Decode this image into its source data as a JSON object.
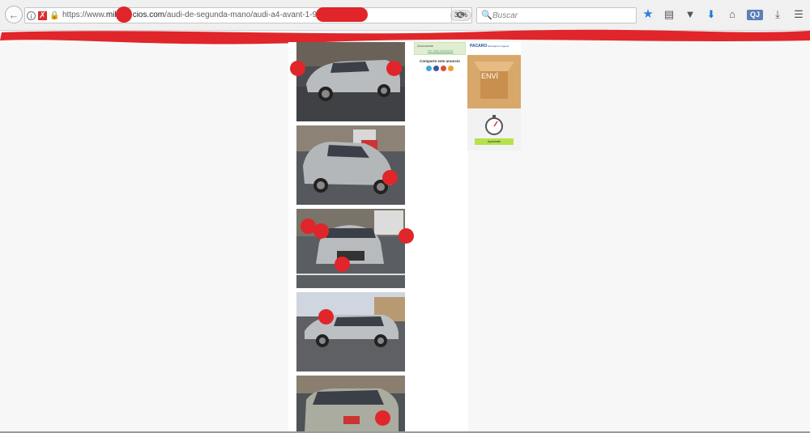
{
  "browser": {
    "back_icon": "arrow-left-icon",
    "url_prefix": "https://www.",
    "url_domain_part1": "mil",
    "url_domain_part2": "cios.com",
    "url_path": "/audi-de-segunda-mano/audi-a4-avant-1-9-tdi-",
    "zoom": "30%",
    "search_placeholder": "Buscar",
    "toolbar_icons": [
      "star-icon",
      "reading-list-icon",
      "pocket-icon",
      "download-icon",
      "home-icon",
      "qj-extension-icon",
      "downloads-icon",
      "menu-icon"
    ],
    "qj_label": "QJ"
  },
  "listing": {
    "photos": [
      {
        "alt": "car-photo-1"
      },
      {
        "alt": "car-photo-2"
      },
      {
        "alt": "car-photo-3"
      },
      {
        "alt": "car-photo-4"
      },
      {
        "alt": "car-photo-5"
      }
    ]
  },
  "sidebar": {
    "contact_line": "Anunciante",
    "contact_link": "ver más anuncios",
    "share_title": "Comparte este anuncio"
  },
  "ad": {
    "brand": "PACARO",
    "tagline": "Mensajería Urgente",
    "box_label": "ENVÍ",
    "button_label": "Apúntate"
  },
  "colors": {
    "accent": "#2a7fe0",
    "redaction": "#e0262a"
  }
}
